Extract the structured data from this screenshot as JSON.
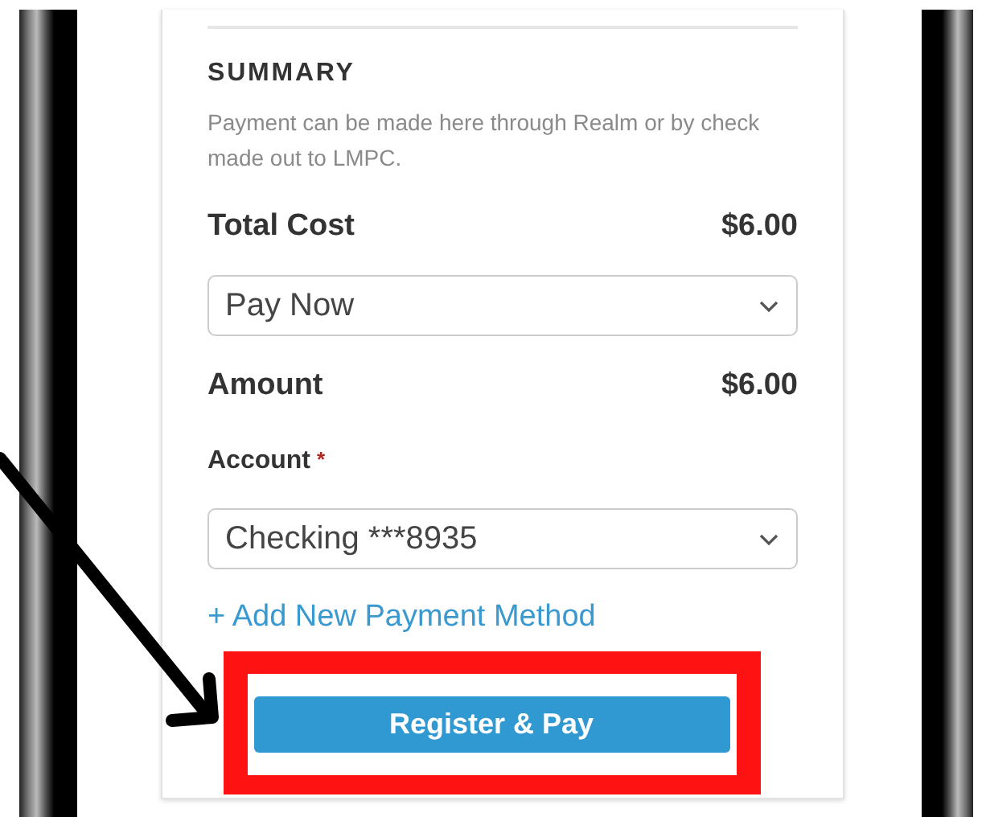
{
  "summary": {
    "heading": "SUMMARY",
    "note": "Payment can be made here through Realm or by check made out to LMPC."
  },
  "total_cost": {
    "label": "Total Cost",
    "value": "$6.00"
  },
  "payment_option": {
    "value": "Pay Now"
  },
  "amount": {
    "label": "Amount",
    "value": "$6.00"
  },
  "account": {
    "label": "Account",
    "required": true,
    "required_mark": "*",
    "value": "Checking ***8935"
  },
  "add_payment_link": "+ Add New Payment Method",
  "submit_button": "Register & Pay"
}
